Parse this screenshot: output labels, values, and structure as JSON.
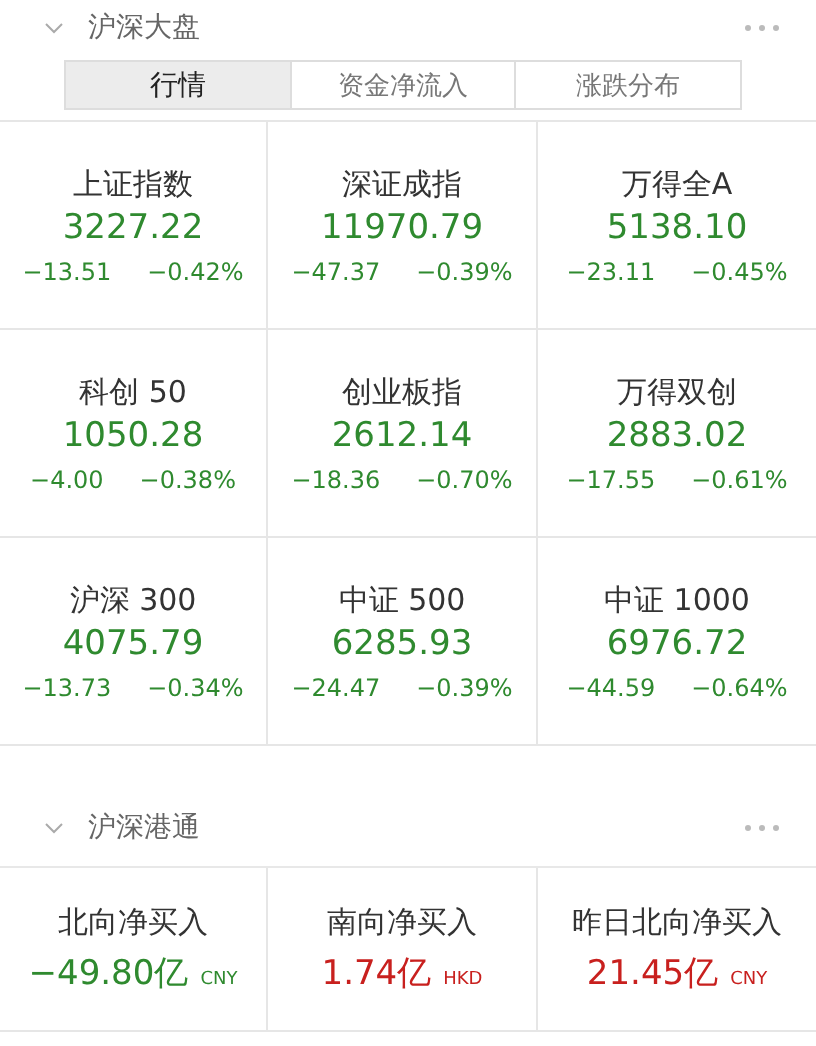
{
  "market": {
    "title": "沪深大盘",
    "expanded": true,
    "tabs": [
      {
        "label": "行情",
        "selected": true
      },
      {
        "label": "资金净流入",
        "selected": false
      },
      {
        "label": "涨跌分布",
        "selected": false
      }
    ],
    "indices": [
      {
        "name": "上证指数",
        "value": "3227.22",
        "change": "−13.51",
        "percent": "−0.42%",
        "color": "#2f8a2f"
      },
      {
        "name": "深证成指",
        "value": "11970.79",
        "change": "−47.37",
        "percent": "−0.39%",
        "color": "#2f8a2f"
      },
      {
        "name": "万得全A",
        "value": "5138.10",
        "change": "−23.11",
        "percent": "−0.45%",
        "color": "#2f8a2f"
      },
      {
        "name": "科创 50",
        "value": "1050.28",
        "change": "−4.00",
        "percent": "−0.38%",
        "color": "#2f8a2f"
      },
      {
        "name": "创业板指",
        "value": "2612.14",
        "change": "−18.36",
        "percent": "−0.70%",
        "color": "#2f8a2f"
      },
      {
        "name": "万得双创",
        "value": "2883.02",
        "change": "−17.55",
        "percent": "−0.61%",
        "color": "#2f8a2f"
      },
      {
        "name": "沪深 300",
        "value": "4075.79",
        "change": "−13.73",
        "percent": "−0.34%",
        "color": "#2f8a2f"
      },
      {
        "name": "中证 500",
        "value": "6285.93",
        "change": "−24.47",
        "percent": "−0.39%",
        "color": "#2f8a2f"
      },
      {
        "name": "中证 1000",
        "value": "6976.72",
        "change": "−44.59",
        "percent": "−0.64%",
        "color": "#2f8a2f"
      }
    ]
  },
  "connect": {
    "title": "沪深港通",
    "expanded": true,
    "flows": [
      {
        "name": "北向净买入",
        "amount": "−49.80亿",
        "currency": "CNY",
        "color": "#2f8a2f"
      },
      {
        "name": "南向净买入",
        "amount": "1.74亿",
        "currency": "HKD",
        "color": "#c8201e"
      },
      {
        "name": "昨日北向净买入",
        "amount": "21.45亿",
        "currency": "CNY",
        "color": "#c8201e"
      }
    ]
  }
}
